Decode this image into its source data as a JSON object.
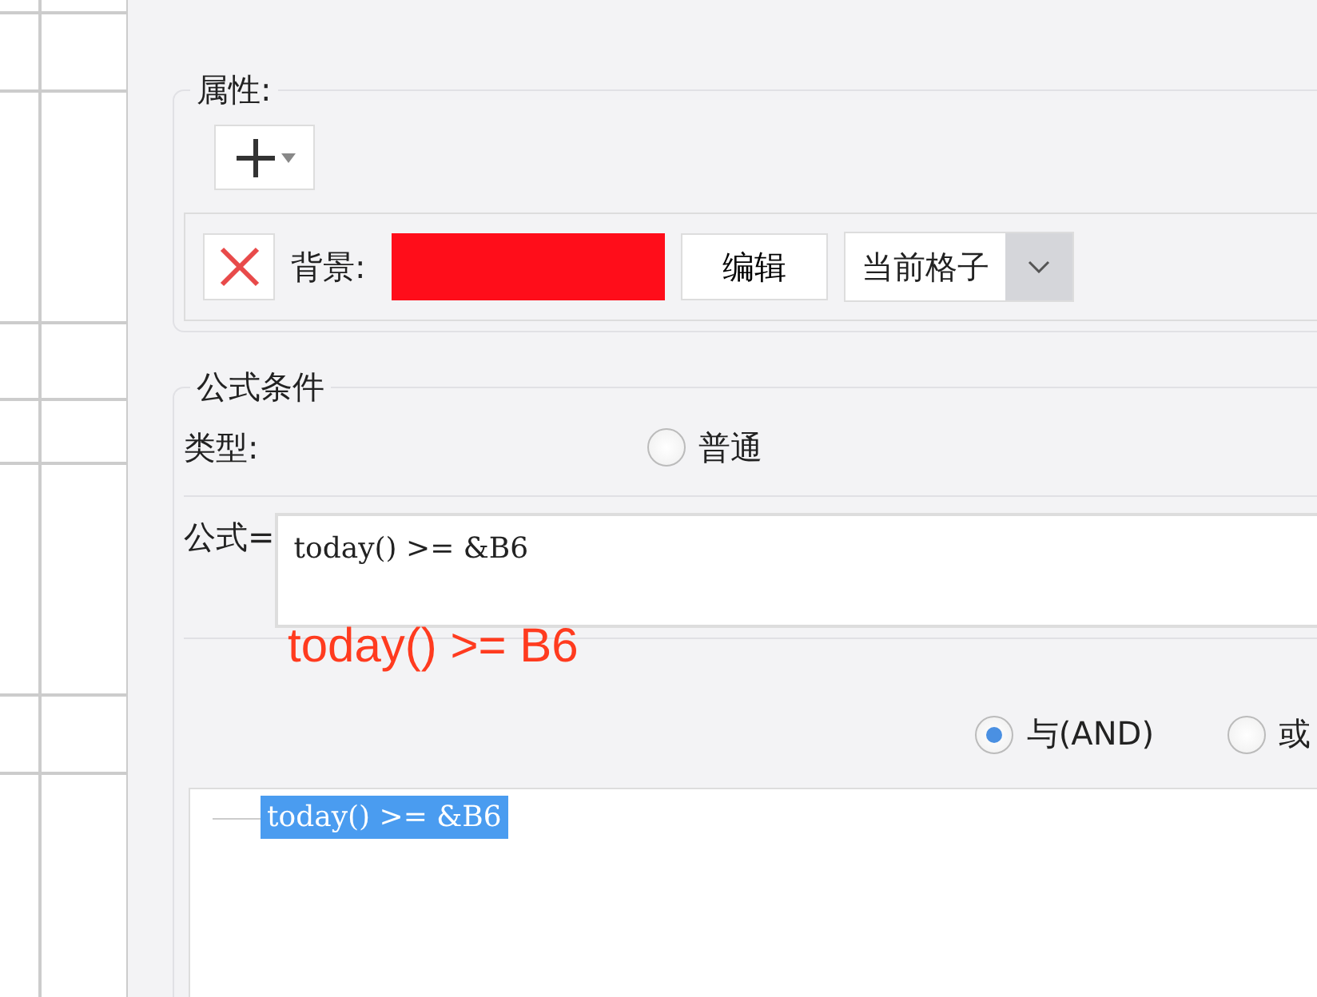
{
  "properties": {
    "legend": "属性:",
    "background_row": {
      "label": "背景:",
      "color": "#ff0d1a",
      "edit_button": "编辑",
      "scope": "当前格子"
    }
  },
  "formula_condition": {
    "legend": "公式条件",
    "type_label": "类型:",
    "type_options": [
      {
        "label": "普通",
        "selected": false
      }
    ],
    "formula_label": "公式=",
    "formula_value": "today() >= &B6",
    "annotation": "today() >= B6",
    "logic_options": [
      {
        "label": "与(AND)",
        "selected": true
      },
      {
        "label": "或",
        "selected": false
      }
    ],
    "tree": [
      {
        "label": "today() >= &B6",
        "selected": true
      }
    ]
  }
}
